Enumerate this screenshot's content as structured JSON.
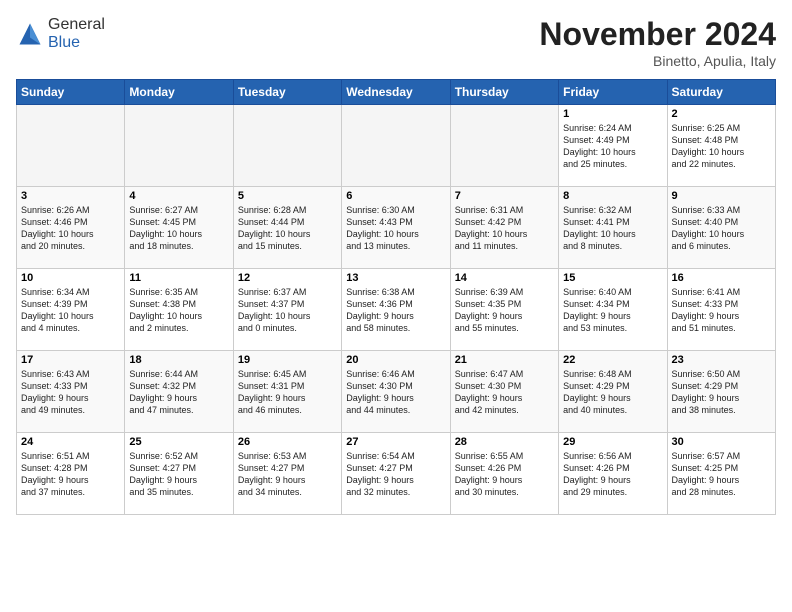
{
  "logo": {
    "general": "General",
    "blue": "Blue"
  },
  "header": {
    "month_title": "November 2024",
    "subtitle": "Binetto, Apulia, Italy"
  },
  "weekdays": [
    "Sunday",
    "Monday",
    "Tuesday",
    "Wednesday",
    "Thursday",
    "Friday",
    "Saturday"
  ],
  "weeks": [
    [
      {
        "day": "",
        "info": ""
      },
      {
        "day": "",
        "info": ""
      },
      {
        "day": "",
        "info": ""
      },
      {
        "day": "",
        "info": ""
      },
      {
        "day": "",
        "info": ""
      },
      {
        "day": "1",
        "info": "Sunrise: 6:24 AM\nSunset: 4:49 PM\nDaylight: 10 hours\nand 25 minutes."
      },
      {
        "day": "2",
        "info": "Sunrise: 6:25 AM\nSunset: 4:48 PM\nDaylight: 10 hours\nand 22 minutes."
      }
    ],
    [
      {
        "day": "3",
        "info": "Sunrise: 6:26 AM\nSunset: 4:46 PM\nDaylight: 10 hours\nand 20 minutes."
      },
      {
        "day": "4",
        "info": "Sunrise: 6:27 AM\nSunset: 4:45 PM\nDaylight: 10 hours\nand 18 minutes."
      },
      {
        "day": "5",
        "info": "Sunrise: 6:28 AM\nSunset: 4:44 PM\nDaylight: 10 hours\nand 15 minutes."
      },
      {
        "day": "6",
        "info": "Sunrise: 6:30 AM\nSunset: 4:43 PM\nDaylight: 10 hours\nand 13 minutes."
      },
      {
        "day": "7",
        "info": "Sunrise: 6:31 AM\nSunset: 4:42 PM\nDaylight: 10 hours\nand 11 minutes."
      },
      {
        "day": "8",
        "info": "Sunrise: 6:32 AM\nSunset: 4:41 PM\nDaylight: 10 hours\nand 8 minutes."
      },
      {
        "day": "9",
        "info": "Sunrise: 6:33 AM\nSunset: 4:40 PM\nDaylight: 10 hours\nand 6 minutes."
      }
    ],
    [
      {
        "day": "10",
        "info": "Sunrise: 6:34 AM\nSunset: 4:39 PM\nDaylight: 10 hours\nand 4 minutes."
      },
      {
        "day": "11",
        "info": "Sunrise: 6:35 AM\nSunset: 4:38 PM\nDaylight: 10 hours\nand 2 minutes."
      },
      {
        "day": "12",
        "info": "Sunrise: 6:37 AM\nSunset: 4:37 PM\nDaylight: 10 hours\nand 0 minutes."
      },
      {
        "day": "13",
        "info": "Sunrise: 6:38 AM\nSunset: 4:36 PM\nDaylight: 9 hours\nand 58 minutes."
      },
      {
        "day": "14",
        "info": "Sunrise: 6:39 AM\nSunset: 4:35 PM\nDaylight: 9 hours\nand 55 minutes."
      },
      {
        "day": "15",
        "info": "Sunrise: 6:40 AM\nSunset: 4:34 PM\nDaylight: 9 hours\nand 53 minutes."
      },
      {
        "day": "16",
        "info": "Sunrise: 6:41 AM\nSunset: 4:33 PM\nDaylight: 9 hours\nand 51 minutes."
      }
    ],
    [
      {
        "day": "17",
        "info": "Sunrise: 6:43 AM\nSunset: 4:33 PM\nDaylight: 9 hours\nand 49 minutes."
      },
      {
        "day": "18",
        "info": "Sunrise: 6:44 AM\nSunset: 4:32 PM\nDaylight: 9 hours\nand 47 minutes."
      },
      {
        "day": "19",
        "info": "Sunrise: 6:45 AM\nSunset: 4:31 PM\nDaylight: 9 hours\nand 46 minutes."
      },
      {
        "day": "20",
        "info": "Sunrise: 6:46 AM\nSunset: 4:30 PM\nDaylight: 9 hours\nand 44 minutes."
      },
      {
        "day": "21",
        "info": "Sunrise: 6:47 AM\nSunset: 4:30 PM\nDaylight: 9 hours\nand 42 minutes."
      },
      {
        "day": "22",
        "info": "Sunrise: 6:48 AM\nSunset: 4:29 PM\nDaylight: 9 hours\nand 40 minutes."
      },
      {
        "day": "23",
        "info": "Sunrise: 6:50 AM\nSunset: 4:29 PM\nDaylight: 9 hours\nand 38 minutes."
      }
    ],
    [
      {
        "day": "24",
        "info": "Sunrise: 6:51 AM\nSunset: 4:28 PM\nDaylight: 9 hours\nand 37 minutes."
      },
      {
        "day": "25",
        "info": "Sunrise: 6:52 AM\nSunset: 4:27 PM\nDaylight: 9 hours\nand 35 minutes."
      },
      {
        "day": "26",
        "info": "Sunrise: 6:53 AM\nSunset: 4:27 PM\nDaylight: 9 hours\nand 34 minutes."
      },
      {
        "day": "27",
        "info": "Sunrise: 6:54 AM\nSunset: 4:27 PM\nDaylight: 9 hours\nand 32 minutes."
      },
      {
        "day": "28",
        "info": "Sunrise: 6:55 AM\nSunset: 4:26 PM\nDaylight: 9 hours\nand 30 minutes."
      },
      {
        "day": "29",
        "info": "Sunrise: 6:56 AM\nSunset: 4:26 PM\nDaylight: 9 hours\nand 29 minutes."
      },
      {
        "day": "30",
        "info": "Sunrise: 6:57 AM\nSunset: 4:25 PM\nDaylight: 9 hours\nand 28 minutes."
      }
    ]
  ]
}
